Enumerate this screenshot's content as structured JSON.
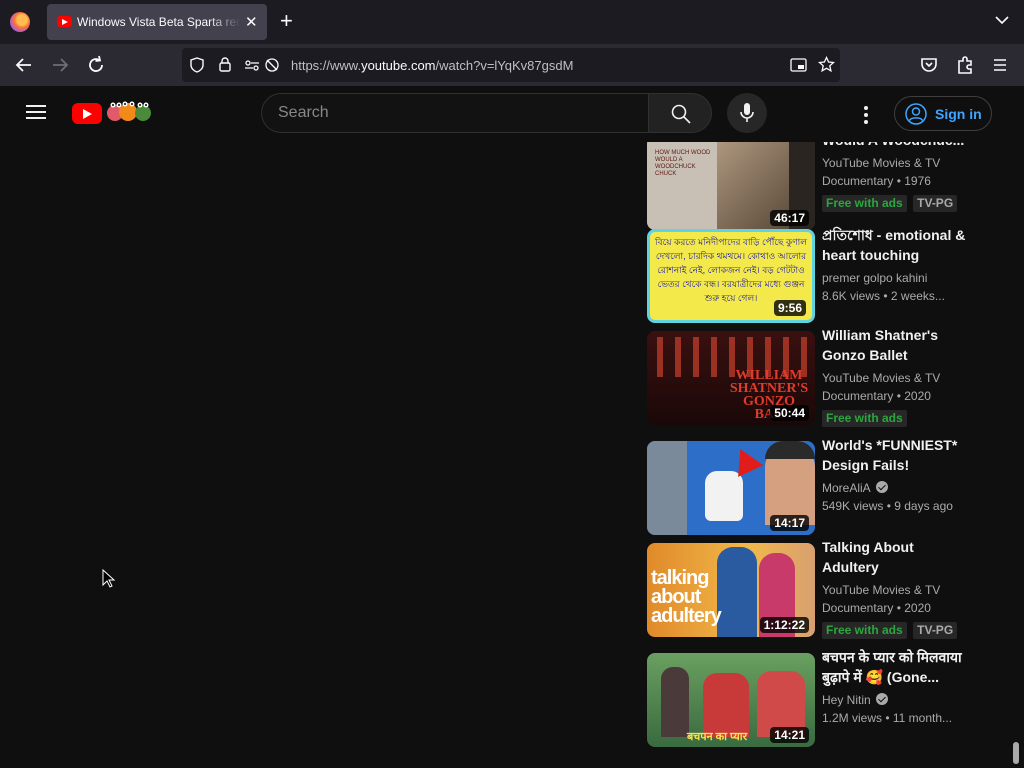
{
  "browser": {
    "tab_title": "Windows Vista Beta Sparta remix",
    "url_prefix": "https://www.",
    "url_domain": "youtube.com",
    "url_path": "/watch?v=lYqKv87gsdM"
  },
  "youtube": {
    "search_placeholder": "Search",
    "sign_in_label": "Sign in",
    "videos": [
      {
        "title": "Would A Woodchuc...",
        "channel": "YouTube Movies & TV",
        "stats": "Documentary • 1976",
        "duration": "46:17",
        "badges": [
          "Free with ads",
          "TV-PG"
        ],
        "thumb_text": "HOW MUCH WOOD WOULD A WOODCHUCK CHUCK"
      },
      {
        "title": "প্রতিশোধ - emotional & heart touching bang...",
        "channel": "premer golpo kahini",
        "stats": "8.6K views • 2 weeks...",
        "duration": "9:56",
        "badges": [],
        "thumb_text": "বিয়ে করতে মনিদীপাদের বাড়ি পৌঁছে কুণাল দেখলো, চারদিক থমথমে। কোথাও আলোর রোশনাই নেই, লোকজন নেই। বড় গেটটাও ভেতর থেকে বন্ধ। বরযাত্রীদের মধ্যে গুঞ্জন শুরু হয়ে গেল।"
      },
      {
        "title": "William Shatner's Gonzo Ballet",
        "channel": "YouTube Movies & TV",
        "stats": "Documentary • 2020",
        "duration": "50:44",
        "badges": [
          "Free with ads"
        ],
        "thumb_text": "WILLIAM SHATNER'S GONZO BAL"
      },
      {
        "title": "World's *FUNNIEST* Design Fails! (HOW!?)",
        "channel": "MoreAliA",
        "stats": "549K views • 9 days ago",
        "duration": "14:17",
        "badges": [],
        "verified": true
      },
      {
        "title": "Talking About Adultery",
        "channel": "YouTube Movies & TV",
        "stats": "Documentary • 2020",
        "duration": "1:12:22",
        "badges": [
          "Free with ads",
          "TV-PG"
        ],
        "thumb_text": "talking about adultery"
      },
      {
        "title": "बचपन के प्यार को मिलवाया बुढ़ापे में 🥰 (Gone...",
        "channel": "Hey Nitin",
        "stats": "1.2M views • 11 month...",
        "duration": "14:21",
        "badges": [],
        "verified": true,
        "thumb_text": "बचपन का प्यार"
      }
    ]
  }
}
